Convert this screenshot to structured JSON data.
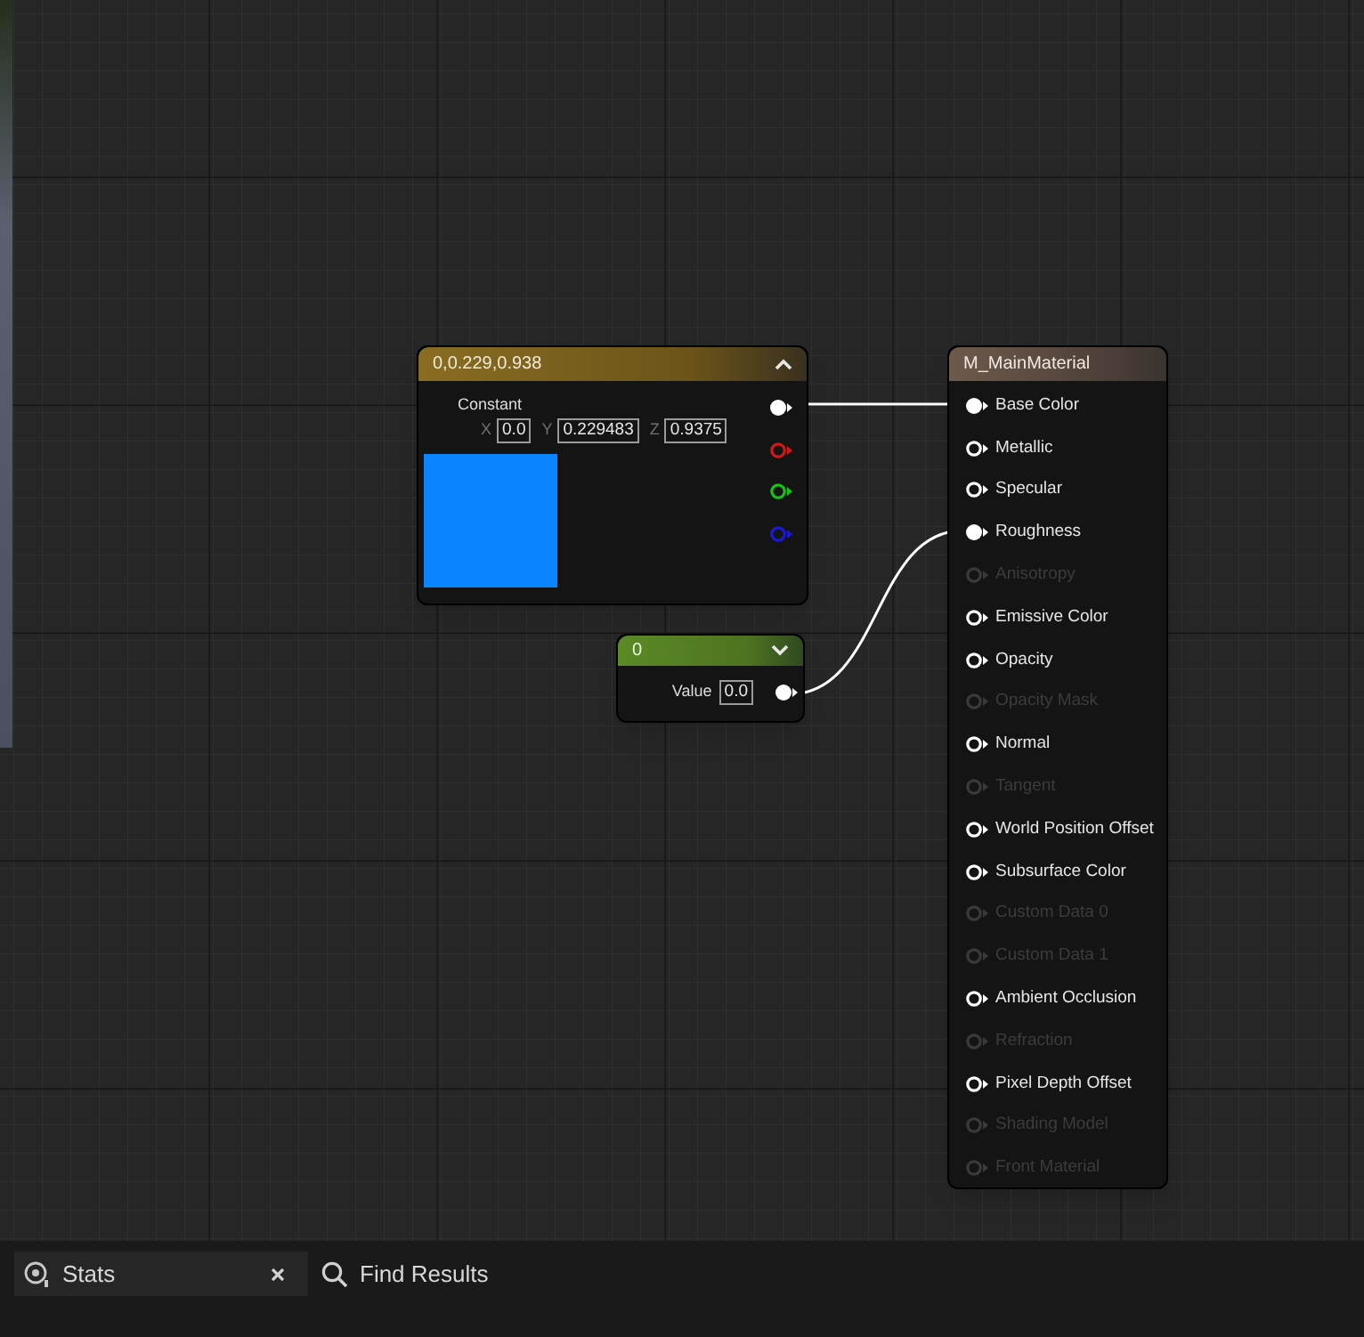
{
  "constant_node": {
    "title": "0,0.229,0.938",
    "label": "Constant",
    "components": [
      {
        "axis": "X",
        "value": "0.0"
      },
      {
        "axis": "Y",
        "value": "0.229483"
      },
      {
        "axis": "Z",
        "value": "0.9375"
      }
    ],
    "outputs": [
      {
        "color": "#ffffff",
        "connected": true
      },
      {
        "color": "#d01818",
        "connected": false
      },
      {
        "color": "#18c018",
        "connected": false
      },
      {
        "color": "#1a1ad8",
        "connected": false
      }
    ]
  },
  "scalar_node": {
    "title": "0",
    "label": "Value",
    "value": "0.0",
    "output_connected": true
  },
  "material_node": {
    "title": "M_MainMaterial",
    "inputs": [
      {
        "label": "Base Color",
        "connected": true,
        "disabled": false
      },
      {
        "label": "Metallic",
        "connected": false,
        "disabled": false
      },
      {
        "label": "Specular",
        "connected": false,
        "disabled": false
      },
      {
        "label": "Roughness",
        "connected": true,
        "disabled": false
      },
      {
        "label": "Anisotropy",
        "connected": false,
        "disabled": true
      },
      {
        "label": "Emissive Color",
        "connected": false,
        "disabled": false
      },
      {
        "label": "Opacity",
        "connected": false,
        "disabled": false
      },
      {
        "label": "Opacity Mask",
        "connected": false,
        "disabled": true
      },
      {
        "label": "Normal",
        "connected": false,
        "disabled": false
      },
      {
        "label": "Tangent",
        "connected": false,
        "disabled": true
      },
      {
        "label": "World Position Offset",
        "connected": false,
        "disabled": false
      },
      {
        "label": "Subsurface Color",
        "connected": false,
        "disabled": false
      },
      {
        "label": "Custom Data 0",
        "connected": false,
        "disabled": true
      },
      {
        "label": "Custom Data 1",
        "connected": false,
        "disabled": true
      },
      {
        "label": "Ambient Occlusion",
        "connected": false,
        "disabled": false
      },
      {
        "label": "Refraction",
        "connected": false,
        "disabled": true
      },
      {
        "label": "Pixel Depth Offset",
        "connected": false,
        "disabled": false
      },
      {
        "label": "Shading Model",
        "connected": false,
        "disabled": true
      },
      {
        "label": "Front Material",
        "connected": false,
        "disabled": true
      }
    ]
  },
  "bottom_tabs": [
    {
      "kind": "stats",
      "label": "Stats",
      "selected": true
    },
    {
      "kind": "search",
      "label": "Find Results",
      "selected": false
    }
  ]
}
